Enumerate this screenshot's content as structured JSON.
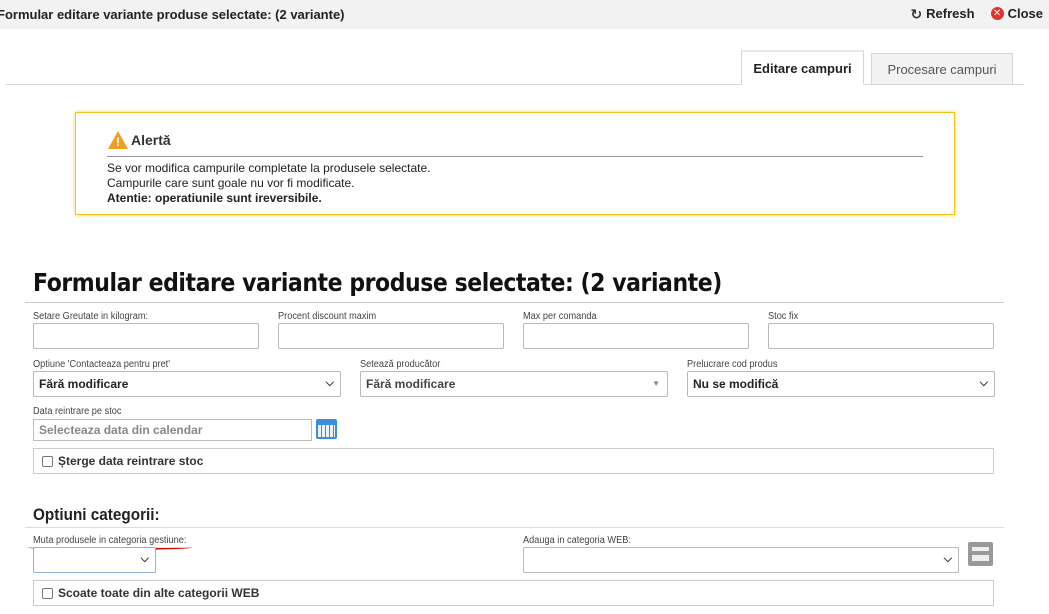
{
  "window": {
    "title": "Formular editare variante produse selectate: (2 variante)",
    "refresh_label": "Refresh",
    "close_label": "Close"
  },
  "tabs": [
    {
      "label": "Editare campuri",
      "active": true
    },
    {
      "label": "Procesare campuri",
      "active": false
    }
  ],
  "alert": {
    "title": "Alertă",
    "line1": "Se vor modifica campurile completate la produsele selectate.",
    "line2": "Campurile care sunt goale nu vor fi modificate.",
    "line3": "Atentie: operatiunile sunt ireversibile."
  },
  "form": {
    "title": "Formular editare variante produse selectate: (2 variante)",
    "fields": {
      "weight_label": "Setare Greutate in kilogram:",
      "discount_label": "Procent discount maxim",
      "max_order_label": "Max per comanda",
      "fixed_stock_label": "Stoc fix",
      "contact_price_label": "Optiune 'Contacteaza pentru pret'",
      "contact_price_value": "Fără modificare",
      "manufacturer_label": "Setează producător",
      "manufacturer_value": "Fără modificare",
      "product_code_label": "Prelucrare cod produs",
      "product_code_value": "Nu se modifică",
      "restock_date_label": "Data reintrare pe stoc",
      "restock_date_placeholder": "Selecteaza data din calendar",
      "clear_restock_label": "Șterge data reintrare stoc"
    }
  },
  "categories": {
    "title": "Optiuni categorii:",
    "move_label": "Muta produsele in categoria gestiune:",
    "move_value": "",
    "add_web_label": "Adauga in categoria WEB:",
    "add_web_value": "",
    "remove_web_label": "Scoate toate din alte categorii WEB"
  },
  "colors": {
    "alert_border": "#f0c419",
    "close_red": "#e0342d",
    "calendar_blue": "#3a8fd8",
    "annotation_red": "#dd0000"
  }
}
